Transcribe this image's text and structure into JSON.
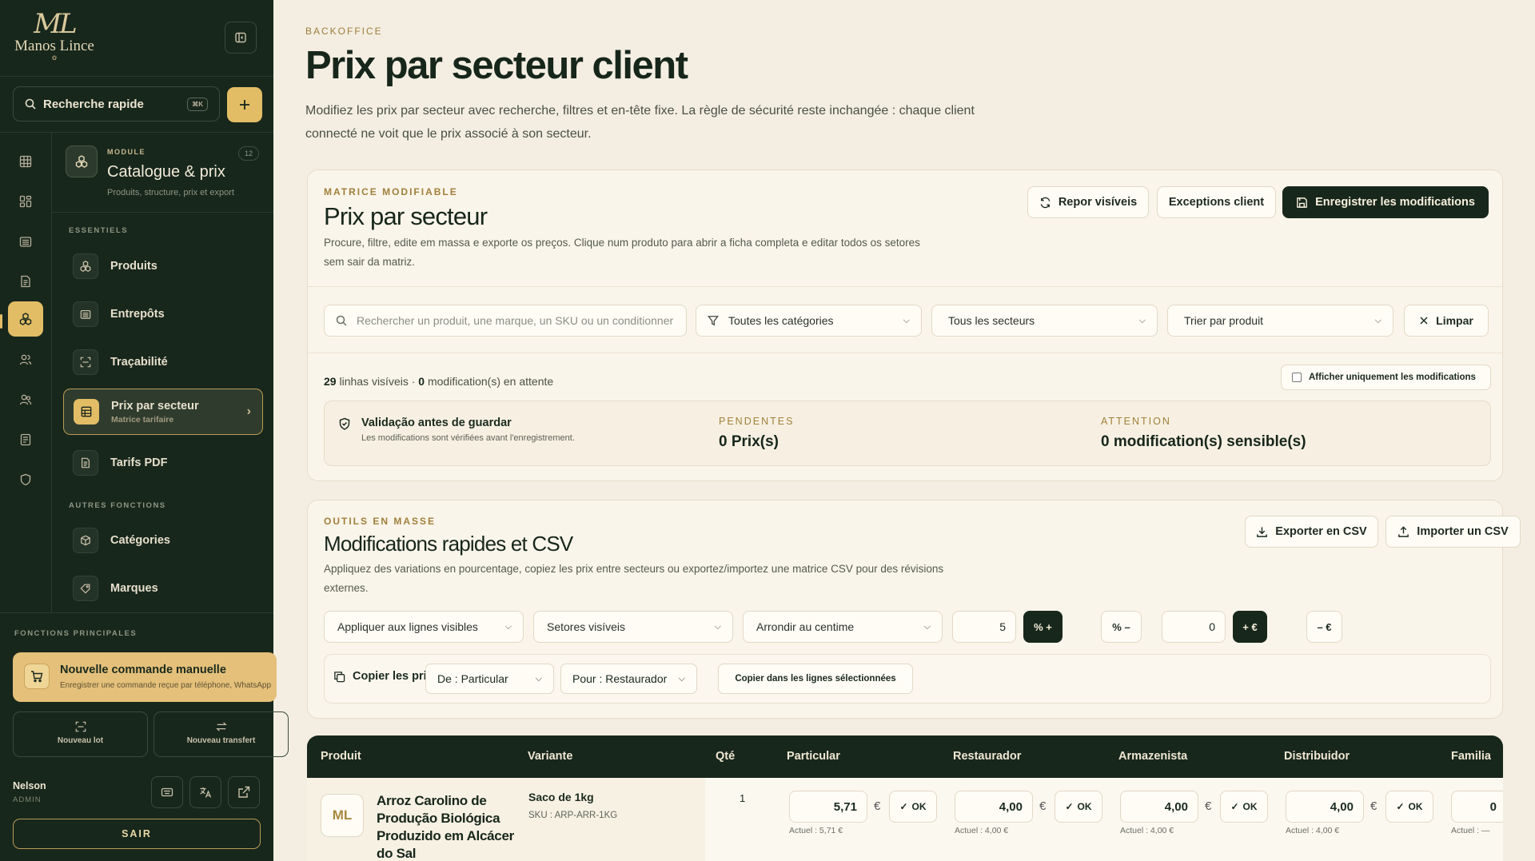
{
  "brand": {
    "mark": "ML",
    "name": "Manos Lince",
    "sub": "✿"
  },
  "sidebar": {
    "search_label": "Recherche rapide",
    "search_kbd": "⌘K",
    "module": {
      "kicker": "MODULE",
      "title": "Catalogue & prix",
      "subtitle": "Produits, structure, prix et export",
      "badge": "12"
    },
    "section_essentials": "ESSENTIELS",
    "section_other": "AUTRES FONCTIONS",
    "items": [
      {
        "label": "Produits"
      },
      {
        "label": "Entrepôts"
      },
      {
        "label": "Traçabilité"
      },
      {
        "label": "Prix par secteur",
        "sub": "Matrice tarifaire"
      },
      {
        "label": "Tarifs PDF"
      },
      {
        "label": "Catégories"
      },
      {
        "label": "Marques"
      }
    ],
    "main_functions": "FONCTIONS PRINCIPALES",
    "new_order": {
      "title": "Nouvelle commande manuelle",
      "subtitle": "Enregistrer une commande reçue par téléphone, WhatsApp"
    },
    "new_lot": "Nouveau lot",
    "new_transfer": "Nouveau transfert",
    "user": {
      "name": "Nelson",
      "role": "ADMIN"
    },
    "logout": "SAIR"
  },
  "header": {
    "kicker": "BACKOFFICE",
    "title": "Prix par secteur client",
    "description": "Modifiez les prix par secteur avec recherche, filtres et en-tête fixe. La règle de sécurité reste inchangée : chaque client connecté ne voit que le prix associé à son secteur."
  },
  "matrix": {
    "kicker": "MATRICE MODIFIABLE",
    "title": "Prix par secteur",
    "description": "Procure, filtre, edite em massa e exporte os preços. Clique num produto para abrir a ficha completa e editar todos os setores sem sair da matriz.",
    "btn_restore": "Repor visíveis",
    "btn_exceptions": "Exceptions client",
    "btn_save": "Enregistrer les modifications",
    "search_placeholder": "Rechercher un produit, une marque, un SKU ou un conditionner",
    "filter_category": "Toutes les catégories",
    "filter_sector": "Tous les secteurs",
    "sort": "Trier par produit",
    "clear": "Limpar",
    "rows_visible": "29",
    "rows_label": "linhas visíveis ·",
    "pending_count": "0",
    "pending_label": "modification(s) en attente",
    "only_mods": "Afficher uniquement les modifications",
    "validation_title": "Validação antes de guardar",
    "validation_sub": "Les modifications sont vérifiées avant l'enregistrement.",
    "pending_k": "PENDENTES",
    "pending_v": "0 Prix(s)",
    "attention_k": "ATTENTION",
    "attention_v": "0 modification(s) sensible(s)"
  },
  "bulk": {
    "kicker": "OUTILS EN MASSE",
    "title": "Modifications rapides et CSV",
    "description": "Appliquez des variations en pourcentage, copiez les prix entre secteurs ou exportez/importez une matrice CSV pour des révisions externes.",
    "btn_export": "Exporter en CSV",
    "btn_import": "Importer un CSV",
    "apply_scope": "Appliquer aux lignes visibles",
    "sectors": "Setores visíveis",
    "rounding": "Arrondir au centime",
    "pct_value": "5",
    "pct_plus": "% +",
    "pct_minus": "% –",
    "eur_value": "0",
    "eur_plus": "+ €",
    "eur_minus": "– €",
    "copy_label": "Copier les prix",
    "copy_from": "De : Particular",
    "copy_to": "Pour : Restaurador",
    "copy_btn": "Copier dans les lignes sélectionnées"
  },
  "table": {
    "columns": [
      "Produit",
      "Variante",
      "Qté",
      "Particular",
      "Restaurador",
      "Armazenista",
      "Distribuidor",
      "Familia"
    ],
    "row": {
      "avatar": "ML",
      "product": "Arroz Carolino de Produção Biológica Produzido em Alcácer do Sal",
      "variant": "Saco de 1kg",
      "sku": "SKU : ARP-ARR-1KG",
      "qty": "1",
      "prices": [
        {
          "value": "5,71",
          "currency": "€",
          "ok": "OK",
          "actual": "Actuel : 5,71 €"
        },
        {
          "value": "4,00",
          "currency": "€",
          "ok": "OK",
          "actual": "Actuel : 4,00 €"
        },
        {
          "value": "4,00",
          "currency": "€",
          "ok": "OK",
          "actual": "Actuel : 4,00 €"
        },
        {
          "value": "4,00",
          "currency": "€",
          "ok": "OK",
          "actual": "Actuel : 4,00 €"
        },
        {
          "value": "0",
          "actual": "Actuel : —"
        }
      ]
    }
  }
}
